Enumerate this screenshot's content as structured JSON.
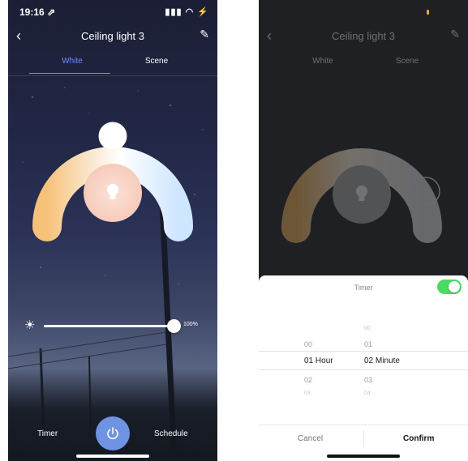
{
  "left_screen": {
    "status": {
      "time": "19:16 ⇗",
      "icons": "▮▮▮ ◠ ⚡"
    },
    "header": {
      "back": "‹",
      "title": "Ceiling light 3",
      "edit": "✎"
    },
    "tabs": [
      {
        "label": "White"
      },
      {
        "label": "Scene"
      }
    ],
    "brightness": {
      "value_label": "100%",
      "level": 1.0
    },
    "bottom_bar": {
      "timer_label": "Timer",
      "schedule_label": "Schedule"
    },
    "colors": {
      "accent": "#6f8dff",
      "power_button": "#6f93e3",
      "warm": "#f6c27a",
      "cool": "#cfe6ff",
      "center_glow": "#f8d4c4"
    }
  },
  "right_screen": {
    "header": {
      "back": "‹",
      "title": "Ceiling light 3",
      "edit": "✎"
    },
    "tabs": [
      {
        "label": "White"
      },
      {
        "label": "Scene"
      }
    ],
    "timer_sheet": {
      "title": "Timer",
      "toggle_on": true,
      "hours": [
        "00",
        "01",
        "02",
        "03"
      ],
      "selected_hour": "01",
      "hour_unit": "Hour",
      "minutes": [
        "00",
        "01",
        "02",
        "03",
        "04"
      ],
      "selected_minute": "02",
      "minute_unit": "Minute",
      "cancel_label": "Cancel",
      "confirm_label": "Confirm"
    },
    "colors": {
      "toggle_on": "#4cd964"
    }
  }
}
